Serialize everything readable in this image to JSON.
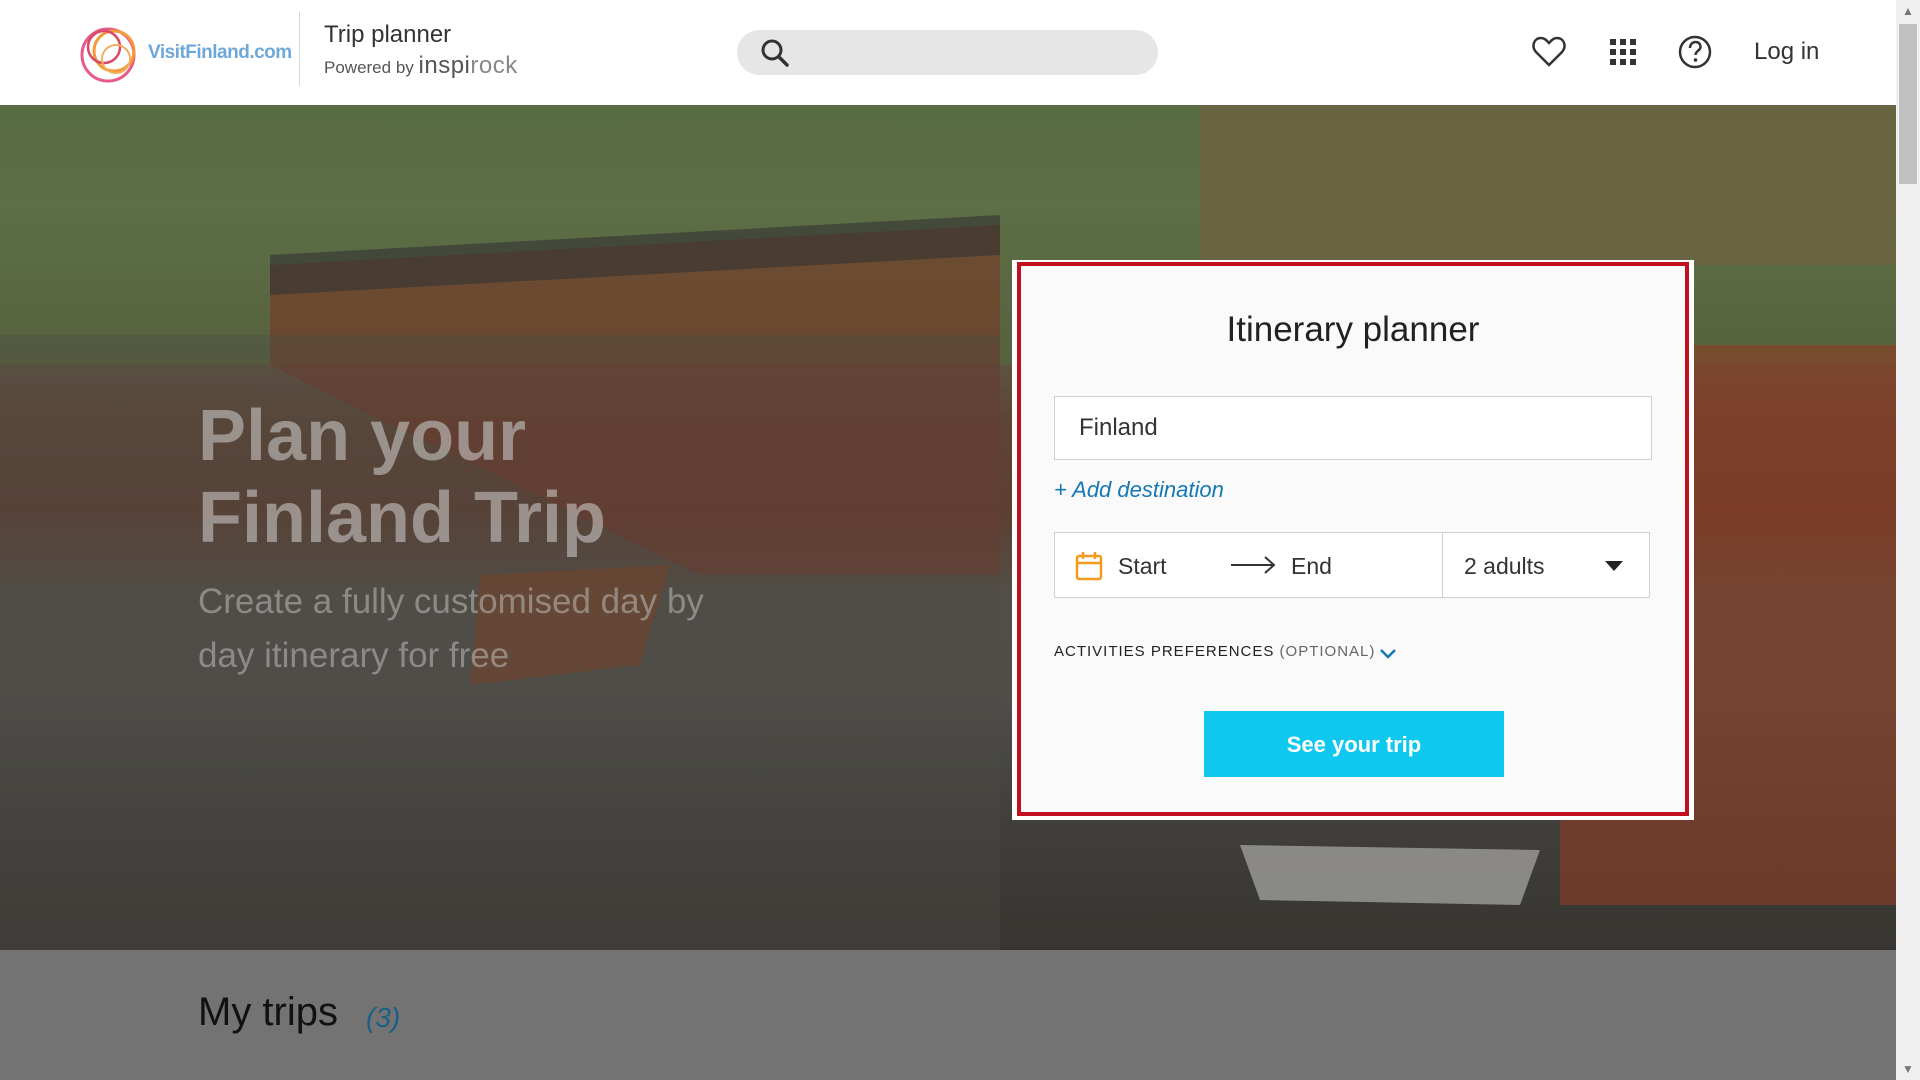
{
  "header": {
    "logo_text": "VisitFinland.com",
    "title": "Trip planner",
    "powered_by": "Powered by",
    "partner_part1": "inspi",
    "partner_part2": "rock",
    "search_placeholder": "",
    "login_label": "Log in",
    "icons": [
      "heart-icon",
      "apps-grid-icon",
      "help-icon"
    ]
  },
  "hero": {
    "title": "Plan your Finland Trip",
    "subtitle": "Create a fully customised day by day itinerary for free"
  },
  "planner": {
    "title": "Itinerary planner",
    "destination_value": "Finland",
    "add_destination": "+ Add destination",
    "start_label": "Start",
    "end_label": "End",
    "travelers_value": "2 adults",
    "activities_label": "ACTIVITIES PREFERENCES",
    "activities_optional": "(OPTIONAL)",
    "submit_label": "See your trip"
  },
  "trips": {
    "heading": "My trips",
    "count": "(3)"
  },
  "colors": {
    "accent": "#0fc8f0",
    "highlight_border": "#c3101e",
    "link": "#1478b4"
  }
}
